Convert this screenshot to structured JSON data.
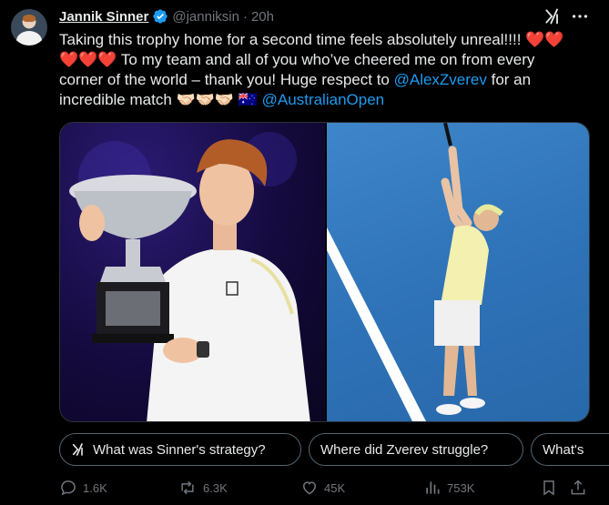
{
  "author": {
    "name": "Jannik Sinner",
    "handle": "@janniksin",
    "separator": "·",
    "time": "20h"
  },
  "tweet": {
    "line1_text": "Taking this trophy home for a second time feels absolutely unreal!!!! ",
    "line1_hearts": "❤️❤️",
    "line2_hearts": "❤️❤️❤️",
    "line2_text": " To my team and all of you who’ve cheered me on from every",
    "line3_text": "corner of the world – thank you! Huge respect to ",
    "mention_zverev": "@AlexZverev",
    "line3_end": " for an",
    "line4_text": "incredible match ",
    "handshake_emojis": "🤝🏻🤝🏻🤝🏻",
    "flag_emoji": "🇦🇺",
    "mention_ao": "@AustralianOpen"
  },
  "suggestions": [
    "What was Sinner's strategy?",
    "Where did Zverev struggle?",
    "What's"
  ],
  "stats": {
    "replies": "1.6K",
    "reposts": "6.3K",
    "likes": "45K",
    "views": "753K"
  },
  "colors": {
    "background": "#000000",
    "text": "#e7e9ea",
    "muted": "#71767b",
    "link": "#1d9bf0",
    "verified": "#1d9bf0",
    "border": "#2f3336"
  },
  "icons": {
    "verified": "verified-badge-icon",
    "grok": "grok-icon",
    "more": "more-icon",
    "reply": "reply-icon",
    "repost": "repost-icon",
    "like": "heart-icon",
    "views": "views-icon",
    "bookmark": "bookmark-icon",
    "share": "share-icon"
  }
}
